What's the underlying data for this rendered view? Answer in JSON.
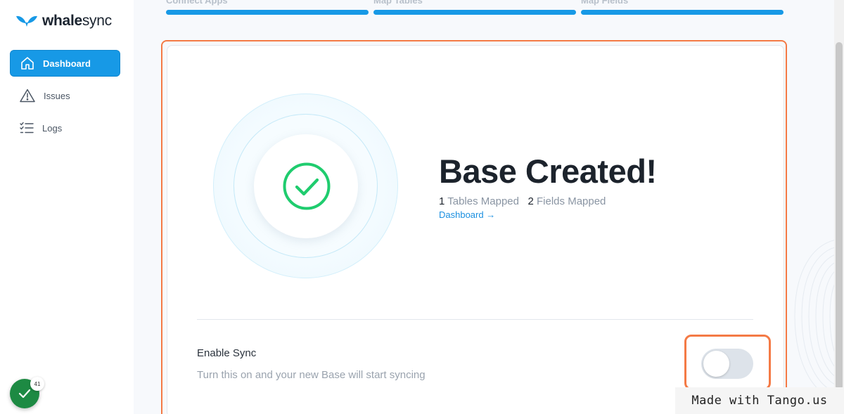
{
  "brand": {
    "name_bold": "whale",
    "name_rest": "sync"
  },
  "sidebar": {
    "items": [
      {
        "label": "Dashboard",
        "icon": "home-icon",
        "active": true
      },
      {
        "label": "Issues",
        "icon": "warning-icon",
        "active": false
      },
      {
        "label": "Logs",
        "icon": "checklist-icon",
        "active": false
      }
    ]
  },
  "steps": [
    {
      "label": "Connect Apps"
    },
    {
      "label": "Map Tables"
    },
    {
      "label": "Map Fields"
    }
  ],
  "result": {
    "title": "Base Created!",
    "tables_count": "1",
    "tables_label": "Tables Mapped",
    "fields_count": "2",
    "fields_label": "Fields Mapped",
    "dashboard_link": "Dashboard →"
  },
  "sync": {
    "title": "Enable Sync",
    "description": "Turn this on and your new Base will start syncing",
    "enabled": false
  },
  "checklist_badge": "41",
  "watermark": "Made with Tango.us",
  "colors": {
    "accent": "#1799e6",
    "highlight": "#f47a45",
    "success": "#1fcc6e",
    "checklist": "#1d8a43"
  }
}
